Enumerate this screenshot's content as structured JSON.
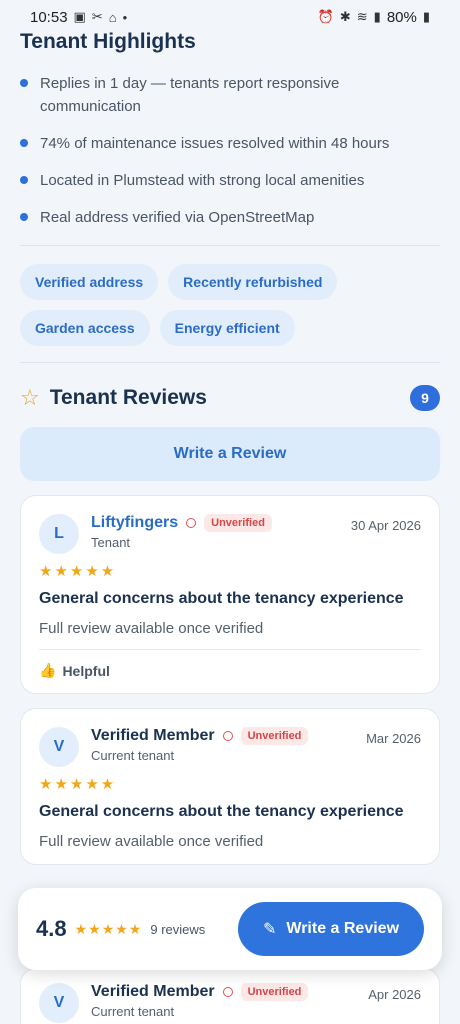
{
  "status": {
    "time": "10:53",
    "battery": "80%"
  },
  "highlights": {
    "title": "Tenant Highlights",
    "items": [
      "Replies in 1 day — tenants report responsive communication",
      "74% of maintenance issues resolved within 48 hours",
      "Located in Plumstead with strong local amenities",
      "Real address verified via OpenStreetMap"
    ],
    "tags": [
      "Verified address",
      "Recently refurbished",
      "Garden access",
      "Energy efficient"
    ]
  },
  "reviews": {
    "title": "Tenant Reviews",
    "count": "9",
    "write_label": "Write a Review",
    "helpful_label": "Helpful",
    "cards": [
      {
        "initial": "L",
        "name": "Liftyfingers",
        "badge": "Unverified",
        "role": "Tenant",
        "date": "30 Apr 2026",
        "stars": "★★★★★",
        "heading": "General concerns about the tenancy experience",
        "body": "Full review available once verified"
      },
      {
        "initial": "V",
        "name": "Verified Member",
        "badge": "Unverified",
        "role": "Current tenant",
        "date": "Mar 2026",
        "stars": "★★★★★",
        "heading": "General concerns about the tenancy experience",
        "body": "Full review available once verified"
      },
      {
        "initial": "V",
        "name": "Verified Member",
        "badge": "Unverified",
        "role": "Current tenant",
        "date": "Apr 2026"
      }
    ]
  },
  "bottom_bar": {
    "rating": "4.8",
    "stars": "★★★★★",
    "count": "9 reviews",
    "button": "Write a Review"
  }
}
